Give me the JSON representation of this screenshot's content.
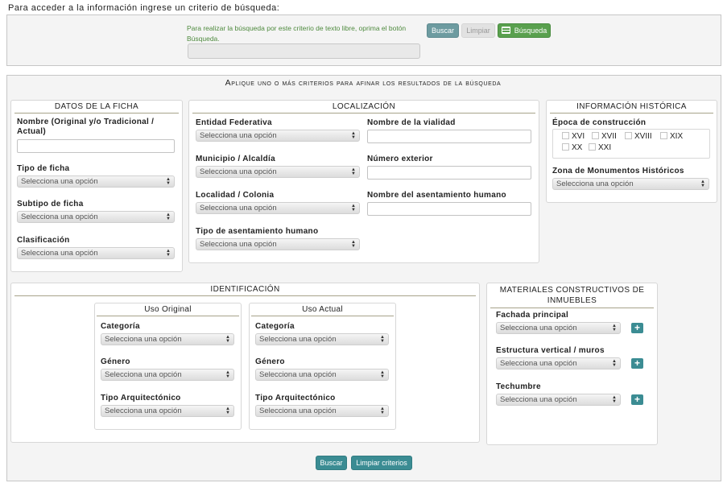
{
  "intro": "Para acceder a la información ingrese un criterio de búsqueda:",
  "free_search": {
    "hint": "Para realizar la búsqueda por este criterio de texto libre, oprima el botón Búsqueda.",
    "value": "",
    "buscar": "Buscar",
    "limpiar": "Limpiar",
    "busqueda": "Búsqueda"
  },
  "filters_title": "Aplique uno o más criterios para afinar los resultados de la búsqueda",
  "placeholder": "Selecciona una opción",
  "ficha": {
    "title": "DATOS DE LA FICHA",
    "nombre": "Nombre (Original y/o Tradicional / Actual)",
    "tipo": "Tipo de ficha",
    "subtipo": "Subtipo de ficha",
    "clasificacion": "Clasificación"
  },
  "localizacion": {
    "title": "LOCALIZACIÓN",
    "entidad": "Entidad Federativa",
    "municipio": "Municipio / Alcaldía",
    "localidad": "Localidad / Colonia",
    "tipo_asentamiento": "Tipo de asentamiento humano",
    "vialidad": "Nombre de la vialidad",
    "numero": "Número exterior",
    "asentamiento": "Nombre del asentamiento humano"
  },
  "historica": {
    "title": "INFORMACIÓN HISTÓRICA",
    "epoca": "Época de construcción",
    "siglos": [
      "XVI",
      "XVII",
      "XVIII",
      "XIX",
      "XX",
      "XXI"
    ],
    "zona": "Zona de Monumentos Históricos"
  },
  "identificacion": {
    "title": "IDENTIFICACIÓN",
    "uso_original": "Uso Original",
    "uso_actual": "Uso Actual",
    "categoria": "Categoría",
    "genero": "Género",
    "tipo_arq": "Tipo Arquitectónico"
  },
  "materiales": {
    "title": "MATERIALES CONSTRUCTIVOS DE INMUEBLES",
    "fachada": "Fachada principal",
    "estructura": "Estructura vertical / muros",
    "techumbre": "Techumbre",
    "add": "+"
  },
  "bottom": {
    "buscar": "Buscar",
    "limpiar": "Limpiar criterios"
  }
}
